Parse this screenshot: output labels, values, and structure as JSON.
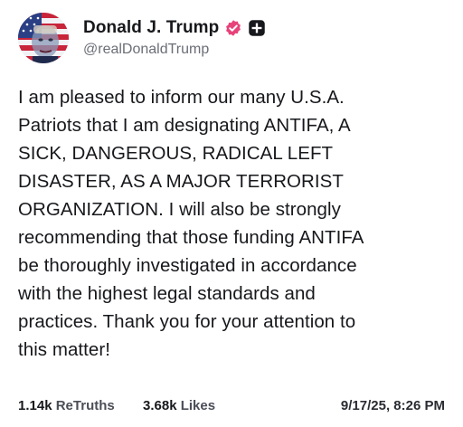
{
  "author": {
    "display_name": "Donald J. Trump",
    "handle": "@realDonaldTrump",
    "avatar_icon": "avatar-flag-portrait",
    "verified_icon": "verified-badge-icon",
    "verified_color": "#e8427a",
    "plus_icon": "plus-badge-icon"
  },
  "post": {
    "lines": [
      "I am pleased to inform our many U.S.A.",
      "Patriots that I am designating ANTIFA, A",
      "SICK, DANGEROUS, RADICAL LEFT",
      "DISASTER, AS A MAJOR TERRORIST",
      "ORGANIZATION. I will also be strongly",
      "recommending that those funding ANTIFA",
      "be thoroughly investigated in accordance",
      "with the highest legal standards and",
      "practices. Thank you for your attention to",
      "this matter!"
    ]
  },
  "stats": {
    "retruths_count": "1.14k",
    "retruths_label": "ReTruths",
    "likes_count": "3.68k",
    "likes_label": "Likes",
    "timestamp": "9/17/25, 8:26 PM"
  }
}
